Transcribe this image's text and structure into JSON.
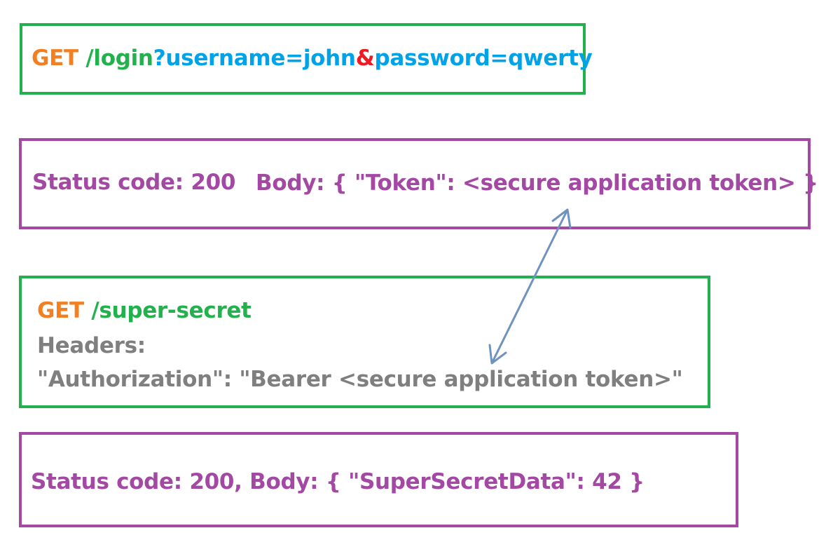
{
  "colors": {
    "green": "#22b14c",
    "purple": "#a349a4",
    "orange": "#f47f20",
    "blue": "#00a2e8",
    "red": "#ed1c24",
    "gray": "#7f7f7f",
    "arrow": "#7092be"
  },
  "login_request": {
    "method": "GET",
    "path": "/login",
    "query_sep": "?",
    "param1": "username=john",
    "amp": "&",
    "param2": "password=qwerty"
  },
  "login_response": {
    "status": "Status code: 200",
    "body": "Body: { \"Token\": <secure application token> }"
  },
  "secret_request": {
    "method": "GET",
    "path": "/super-secret",
    "headers_label": "Headers:",
    "auth_header": "\"Authorization\": \"Bearer <secure application token>\""
  },
  "secret_response": {
    "text": "Status code: 200, Body: { \"SuperSecretData\": 42 }"
  }
}
